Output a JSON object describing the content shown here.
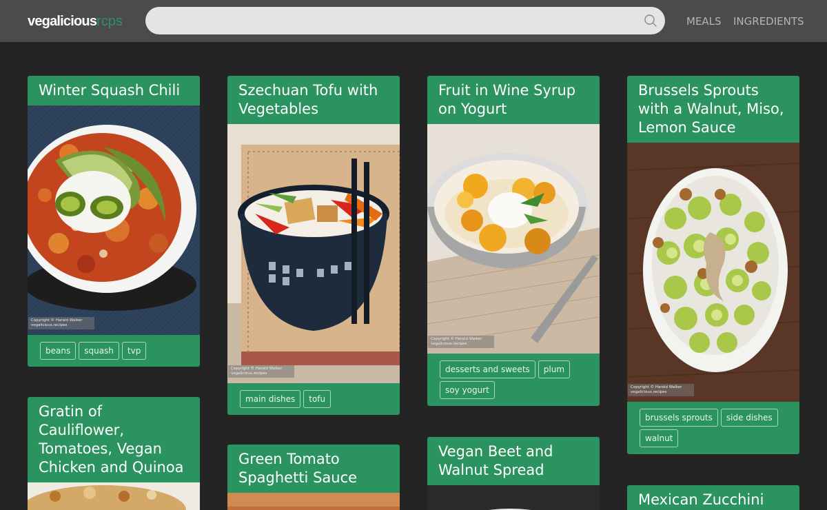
{
  "brand": {
    "name": "vegalicious",
    "accent": "rcps",
    "accent_color": "#2b9360"
  },
  "search": {
    "placeholder": "",
    "value": "",
    "icon": "search-icon"
  },
  "nav": {
    "meals": "MEALS",
    "ingredients": "INGREDIENTS"
  },
  "cards": [
    {
      "title": "Winter Squash Chili",
      "copyright": "Copyright © Harald Walker",
      "copyright_site": "vegalicious.recipes",
      "tags": [
        "beans",
        "squash",
        "tvp"
      ]
    },
    {
      "title": "Szechuan Tofu with Vegetables",
      "copyright": "Copyright © Harald Walker",
      "copyright_site": "vegalicious.recipes",
      "tags": [
        "main dishes",
        "tofu"
      ]
    },
    {
      "title": "Fruit in Wine Syrup on Yogurt",
      "copyright": "Copyright © Harald Walker",
      "copyright_site": "vegalicious.recipes",
      "tags": [
        "desserts and sweets",
        "plum",
        "soy yogurt"
      ]
    },
    {
      "title": "Brussels Sprouts with a Walnut, Miso, Lemon Sauce",
      "copyright": "Copyright © Harald Walker",
      "copyright_site": "vegalicious.recipes",
      "tags": [
        "brussels sprouts",
        "side dishes",
        "walnut"
      ]
    },
    {
      "title": "Gratin of Cauliflower, Tomatoes, Vegan Chicken and Quinoa"
    },
    {
      "title": "Green Tomato Spaghetti Sauce"
    },
    {
      "title": "Vegan Beet and Walnut Spread"
    },
    {
      "title": "Mexican Zucchini"
    }
  ]
}
